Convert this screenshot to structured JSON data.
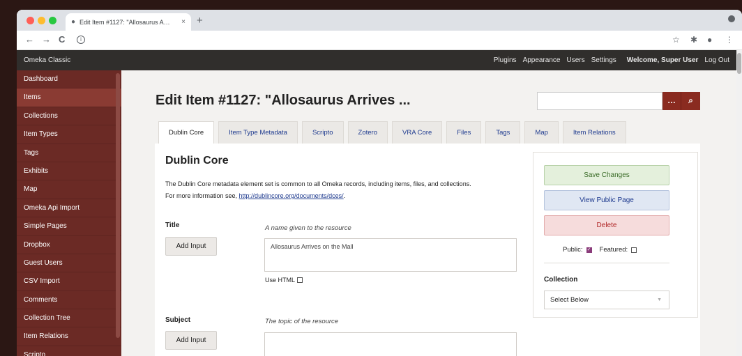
{
  "browser": {
    "tab_title": "Edit Item #1127: \"Allosaurus A…",
    "tab_close": "×",
    "new_tab": "+",
    "nav_back": "←",
    "nav_forward": "→",
    "reload": "C",
    "info": "i",
    "star": "☆",
    "extensions": "✱",
    "profile": "●",
    "menu": "⋮"
  },
  "adminbar": {
    "site_title": "Omeka Classic",
    "links": [
      "Plugins",
      "Appearance",
      "Users",
      "Settings"
    ],
    "welcome": "Welcome, Super User",
    "logout": "Log Out"
  },
  "sidebar": {
    "items": [
      "Dashboard",
      "Items",
      "Collections",
      "Item Types",
      "Tags",
      "Exhibits",
      "Map",
      "Omeka Api Import",
      "Simple Pages",
      "Dropbox",
      "Guest Users",
      "CSV Import",
      "Comments",
      "Collection Tree",
      "Item Relations",
      "Scripto"
    ],
    "active_index": 1
  },
  "main": {
    "page_title": "Edit Item #1127: \"Allosaurus Arrives ...",
    "search": {
      "placeholder": "",
      "advanced_label": "…",
      "go_icon": "⌕"
    },
    "tabs": [
      "Dublin Core",
      "Item Type Metadata",
      "Scripto",
      "Zotero",
      "VRA Core",
      "Files",
      "Tags",
      "Map",
      "Item Relations"
    ],
    "active_tab_index": 0,
    "section_title": "Dublin Core",
    "section_desc_1": "The Dublin Core metadata element set is common to all Omeka records, including items, files, and collections.",
    "section_desc_2_prefix": "For more information see, ",
    "section_desc_link": "http://dublincore.org/documents/dces/",
    "section_desc_2_suffix": ".",
    "fields": [
      {
        "label": "Title",
        "description": "A name given to the resource",
        "add_input": "Add Input",
        "value": "Allosaurus Arrives on the Mall",
        "use_html": "Use HTML"
      },
      {
        "label": "Subject",
        "description": "The topic of the resource",
        "add_input": "Add Input",
        "value": ""
      }
    ]
  },
  "save_panel": {
    "save": "Save Changes",
    "view": "View Public Page",
    "delete": "Delete",
    "public_label": "Public:",
    "public_checked": true,
    "featured_label": "Featured:",
    "featured_checked": false,
    "collection_label": "Collection",
    "collection_value": "Select Below"
  },
  "colors": {
    "sidebar": "#6b2a25",
    "adminbar": "#302e2c",
    "accent": "#8a2b20",
    "link": "#1f3b8f"
  }
}
